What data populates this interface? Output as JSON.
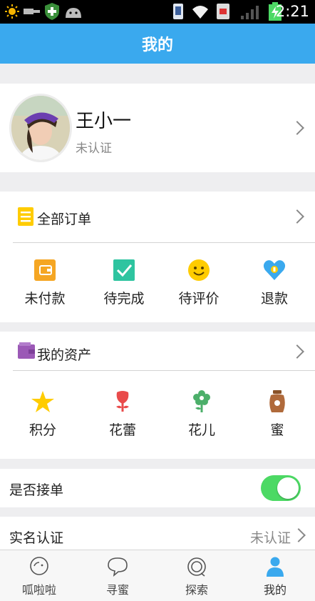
{
  "status_bar": {
    "time": "2:21",
    "icons": [
      "weather-sun-icon",
      "usb-icon",
      "shield-icon",
      "android-icon",
      "vibrate-icon",
      "wifi-icon",
      "sim-icon",
      "signal-icon",
      "battery-charging-icon"
    ]
  },
  "header": {
    "title": "我的"
  },
  "profile": {
    "name": "王小一",
    "status": "未认证",
    "avatar": "avatar-photo"
  },
  "orders": {
    "title": "全部订单",
    "icon": "order-list-icon",
    "items": [
      {
        "label": "未付款",
        "icon": "wallet-icon",
        "color": "#f5a623"
      },
      {
        "label": "待完成",
        "icon": "checkbox-icon",
        "color": "#2ec4a0"
      },
      {
        "label": "待评价",
        "icon": "smiley-icon",
        "color": "#ffcc00"
      },
      {
        "label": "退款",
        "icon": "refund-heart-icon",
        "color": "#3aa9ee"
      }
    ]
  },
  "assets": {
    "title": "我的资产",
    "icon": "purse-icon",
    "items": [
      {
        "label": "积分",
        "icon": "star-icon",
        "color": "#ffcc00"
      },
      {
        "label": "花蕾",
        "icon": "rose-bud-icon",
        "color": "#e94b4b"
      },
      {
        "label": "花儿",
        "icon": "flower-icon",
        "color": "#4caf6a"
      },
      {
        "label": "蜜",
        "icon": "honey-jar-icon",
        "color": "#b06a3b"
      }
    ]
  },
  "accept_orders": {
    "label": "是否接单",
    "enabled": true
  },
  "verification": {
    "label": "实名认证",
    "value": "未认证"
  },
  "tabs": [
    {
      "label": "呱啦啦",
      "icon": "chat-bubble-icon",
      "active": false
    },
    {
      "label": "寻蜜",
      "icon": "speech-bubble-icon",
      "active": false
    },
    {
      "label": "探索",
      "icon": "explore-icon",
      "active": false
    },
    {
      "label": "我的",
      "icon": "person-icon",
      "active": true
    }
  ],
  "colors": {
    "accent": "#3aa9ee",
    "toggle_on": "#4cd964",
    "background": "#eeeef0"
  }
}
